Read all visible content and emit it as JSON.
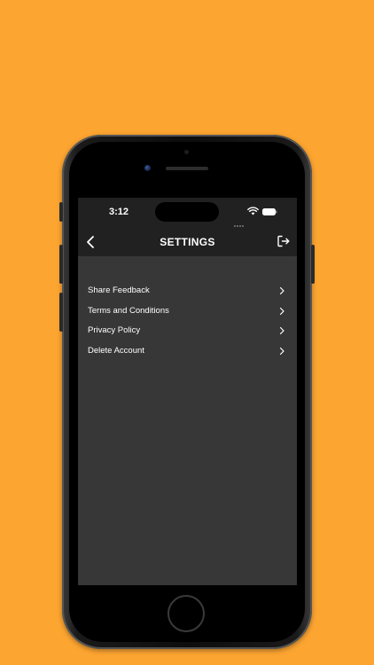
{
  "status_bar": {
    "time": "3:12"
  },
  "header": {
    "title": "SETTINGS"
  },
  "icons": {
    "back": "chevron-left-icon",
    "logout": "logout-icon",
    "item_chevron": "chevron-right-icon"
  },
  "menu": {
    "items": [
      {
        "label": "Share Feedback"
      },
      {
        "label": "Terms and Conditions"
      },
      {
        "label": "Privacy Policy"
      },
      {
        "label": "Delete Account"
      }
    ]
  },
  "colors": {
    "background": "#FDA531",
    "screen_bg": "#373737",
    "bar_bg": "#212121",
    "text": "#FFFFFF"
  }
}
